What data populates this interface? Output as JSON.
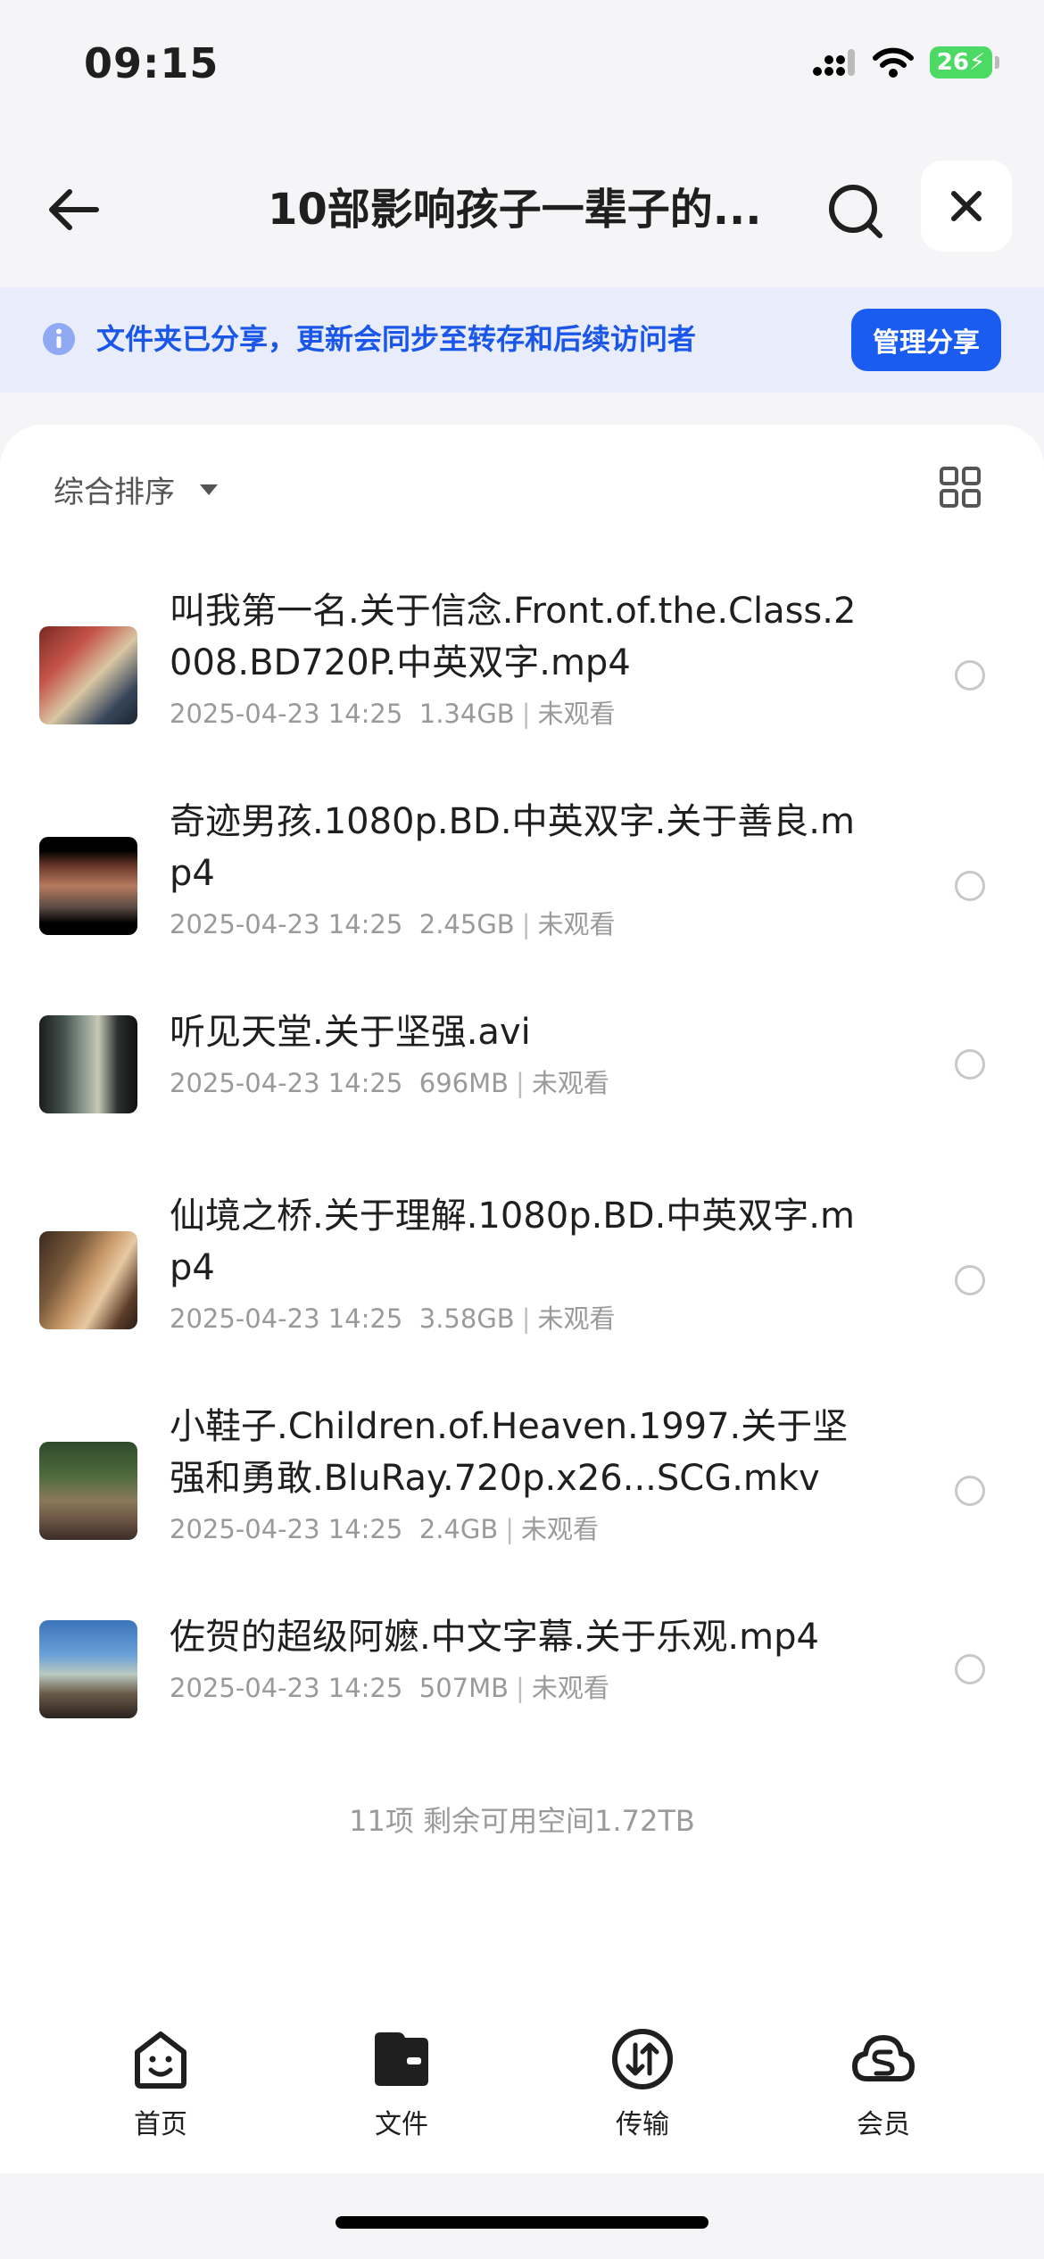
{
  "status": {
    "time": "09:15",
    "battery": "26"
  },
  "nav": {
    "title": "10部影响孩子一辈子的..."
  },
  "banner": {
    "text": "文件夹已分享，更新会同步至转存和后续访问者",
    "button": "管理分享"
  },
  "sort": {
    "label": "综合排序"
  },
  "files": [
    {
      "name": "叫我第一名.关于信念.Front.of.the.Class.2008.BD720P.中英双字.mp4",
      "date": "2025-04-23 14:25",
      "size": "1.34GB",
      "status": "未观看"
    },
    {
      "name": "奇迹男孩.1080p.BD.中英双字.关于善良.mp4",
      "date": "2025-04-23 14:25",
      "size": "2.45GB",
      "status": "未观看"
    },
    {
      "name": "听见天堂.关于坚强.avi",
      "date": "2025-04-23 14:25",
      "size": "696MB",
      "status": "未观看"
    },
    {
      "name": "仙境之桥.关于理解.1080p.BD.中英双字.mp4",
      "date": "2025-04-23 14:25",
      "size": "3.58GB",
      "status": "未观看"
    },
    {
      "name": "小鞋子.Children.of.Heaven.1997.关于坚强和勇敢.BluRay.720p.x26...SCG.mkv",
      "date": "2025-04-23 14:25",
      "size": "2.4GB",
      "status": "未观看"
    },
    {
      "name": "佐贺的超级阿嬷.中文字幕.关于乐观.mp4",
      "date": "2025-04-23 14:25",
      "size": "507MB",
      "status": "未观看"
    }
  ],
  "footer": {
    "summary": "11项 剩余可用空间1.72TB"
  },
  "tabs": [
    {
      "label": "首页",
      "icon": "smile-face-icon"
    },
    {
      "label": "文件",
      "icon": "folder-icon"
    },
    {
      "label": "传输",
      "icon": "transfer-icon"
    },
    {
      "label": "会员",
      "icon": "cloud-member-icon"
    }
  ],
  "colors": {
    "accent": "#1a5cf0",
    "banner_bg": "#e8ecfb",
    "banner_text": "#1a56e8"
  }
}
